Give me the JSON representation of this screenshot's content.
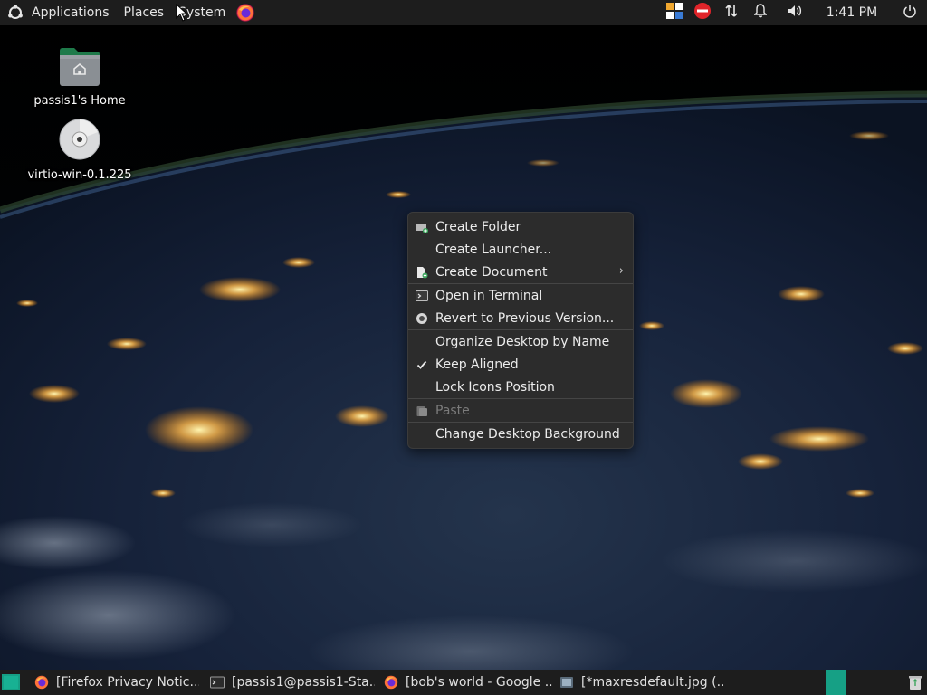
{
  "top_panel": {
    "menus": [
      {
        "label": "Applications",
        "icon": "ubuntu-logo-icon"
      },
      {
        "label": "Places"
      },
      {
        "label": "System"
      }
    ],
    "launchers": [
      {
        "icon": "firefox-icon"
      }
    ],
    "tray": [
      {
        "icon": "indicator-multiload-icon"
      },
      {
        "icon": "do-not-disturb-icon"
      },
      {
        "icon": "network-icon"
      },
      {
        "icon": "notification-bell-icon"
      },
      {
        "icon": "volume-icon"
      }
    ],
    "clock": "1:41 PM",
    "power_icon": "power-icon"
  },
  "desktop_icons": [
    {
      "label": "passis1's Home",
      "icon": "home-folder-icon"
    },
    {
      "label": "virtio-win-0.1.225",
      "icon": "optical-disc-icon"
    }
  ],
  "context_menu": {
    "items": [
      {
        "label": "Create Folder",
        "icon": "folder-new-icon",
        "enabled": true
      },
      {
        "label": "Create Launcher...",
        "enabled": true
      },
      {
        "label": "Create Document",
        "icon": "document-new-icon",
        "has_submenu": true,
        "enabled": true
      },
      {
        "separator": true
      },
      {
        "label": "Open in Terminal",
        "icon": "terminal-icon",
        "enabled": true
      },
      {
        "label": "Revert to Previous Version...",
        "icon": "revert-icon",
        "enabled": true
      },
      {
        "separator": true
      },
      {
        "label": "Organize Desktop by Name",
        "enabled": true
      },
      {
        "label": "Keep Aligned",
        "checked": true,
        "enabled": true
      },
      {
        "label": "Lock Icons Position",
        "enabled": true
      },
      {
        "separator": true
      },
      {
        "label": "Paste",
        "icon": "paste-icon",
        "enabled": false
      },
      {
        "separator": true
      },
      {
        "label": "Change Desktop Background",
        "enabled": true
      }
    ]
  },
  "bottom_panel": {
    "show_desktop_icon": "show-desktop-icon",
    "tasks": [
      {
        "label": "[Firefox Privacy Notic...",
        "icon": "firefox-icon"
      },
      {
        "label": "[passis1@passis1-Sta...",
        "icon": "terminal-icon"
      },
      {
        "label": "[bob's world - Google ...",
        "icon": "firefox-icon"
      },
      {
        "label": "[*maxresdefault.jpg (...",
        "icon": "image-editor-icon"
      }
    ],
    "workspace_icon": "workspace-switcher-icon",
    "trash_icon": "trash-icon"
  },
  "colors": {
    "panel_bg": "#1d1d1d",
    "menu_bg": "#2c2c2c",
    "menu_text": "#ececec",
    "disabled_text": "#7b7b7b",
    "accent_green": "#16a085"
  }
}
